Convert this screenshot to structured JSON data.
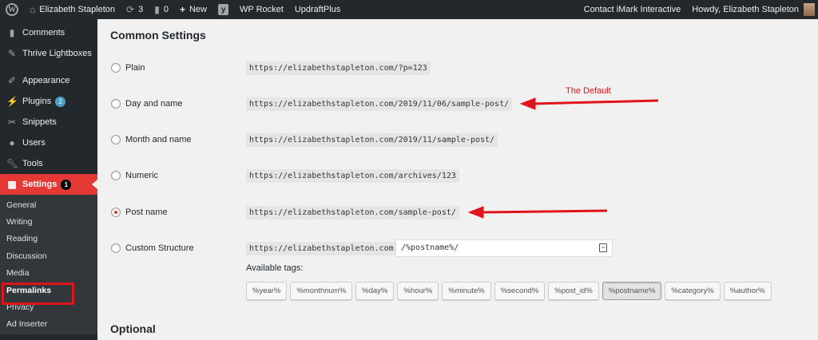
{
  "adminbar": {
    "site_name": "Elizabeth Stapleton",
    "updates_count": "3",
    "comments_count": "0",
    "new_label": "New",
    "wp_rocket": "WP Rocket",
    "updraft": "UpdraftPlus",
    "contact": "Contact iMark Interactive",
    "howdy": "Howdy, Elizabeth Stapleton"
  },
  "sidebar": {
    "items": [
      {
        "label": "Comments",
        "icon": "comment-icon"
      },
      {
        "label": "Thrive Lightboxes",
        "icon": "pin-icon"
      },
      {
        "label": "Appearance",
        "icon": "brush-icon"
      },
      {
        "label": "Plugins",
        "icon": "plugin-icon",
        "badge": "2"
      },
      {
        "label": "Snippets",
        "icon": "scissors-icon"
      },
      {
        "label": "Users",
        "icon": "user-icon"
      },
      {
        "label": "Tools",
        "icon": "wrench-icon"
      },
      {
        "label": "Settings",
        "icon": "settings-icon",
        "badge": "1"
      }
    ],
    "submenu": [
      "General",
      "Writing",
      "Reading",
      "Discussion",
      "Media",
      "Permalinks",
      "Privacy",
      "Ad Inserter"
    ]
  },
  "main": {
    "title": "Common Settings",
    "options": [
      {
        "label": "Plain",
        "url": "https://elizabethstapleton.com/?p=123",
        "checked": false
      },
      {
        "label": "Day and name",
        "url": "https://elizabethstapleton.com/2019/11/06/sample-post/",
        "checked": false
      },
      {
        "label": "Month and name",
        "url": "https://elizabethstapleton.com/2019/11/sample-post/",
        "checked": false
      },
      {
        "label": "Numeric",
        "url": "https://elizabethstapleton.com/archives/123",
        "checked": false
      },
      {
        "label": "Post name",
        "url": "https://elizabethstapleton.com/sample-post/",
        "checked": true
      },
      {
        "label": "Custom Structure",
        "url": "https://elizabethstapleton.com",
        "checked": false
      }
    ],
    "custom_value": "/%postname%/",
    "available_tags_label": "Available tags:",
    "tags": [
      "%year%",
      "%monthnum%",
      "%day%",
      "%hour%",
      "%minute%",
      "%second%",
      "%post_id%",
      "%postname%",
      "%category%",
      "%author%"
    ],
    "active_tag": "%postname%",
    "optional_title": "Optional",
    "annotation": "The Default"
  },
  "colors": {
    "accent": "#e53935",
    "annotation": "#e0141b",
    "adminbar": "#23282d"
  }
}
